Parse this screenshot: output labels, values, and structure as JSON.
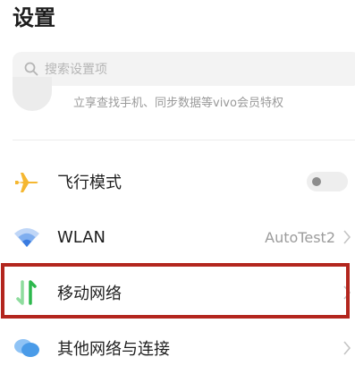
{
  "header": {
    "title": "设置"
  },
  "search": {
    "placeholder": "搜索设置项"
  },
  "account": {
    "subtitle": "立享查找手机、同步数据等vivo会员特权"
  },
  "settings": {
    "airplane_mode": {
      "label": "飞行模式",
      "toggle_on": false,
      "icon": "airplane-icon",
      "icon_color": "#F5B731"
    },
    "wlan": {
      "label": "WLAN",
      "value": "AutoTest2",
      "icon": "wifi-icon",
      "icon_color": "#3A7BE0"
    },
    "mobile_network": {
      "label": "移动网络",
      "icon": "mobile-data-icon",
      "icon_color": "#2DB84D",
      "highlighted": true
    },
    "other_networks": {
      "label": "其他网络与连接",
      "icon": "connections-icon",
      "icon_color": "#4A9BE8"
    }
  },
  "colors": {
    "highlight_border": "#B3261E",
    "chevron": "#C4C4C4",
    "secondary_text": "#9C9C9C"
  }
}
